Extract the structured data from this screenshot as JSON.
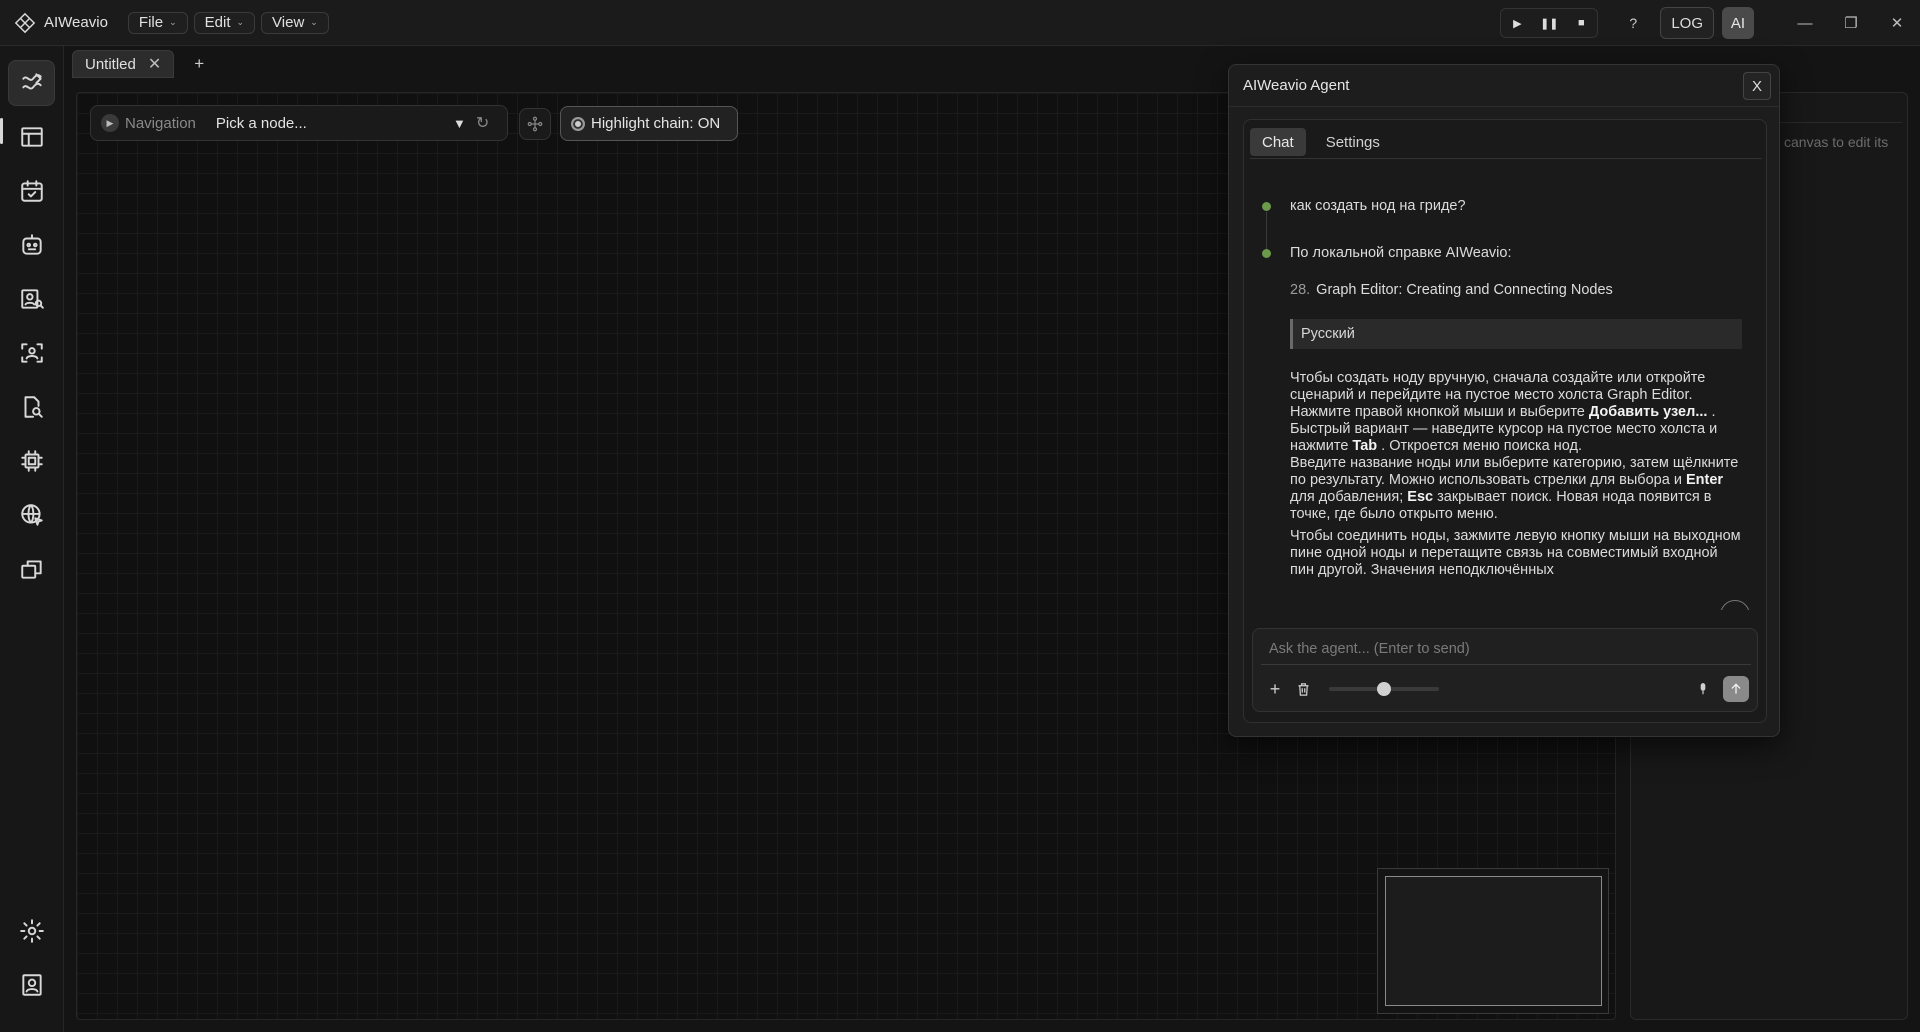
{
  "app": {
    "name": "AIWeavio",
    "menus": [
      "File",
      "Edit",
      "View"
    ]
  },
  "titlebar": {
    "help_label": "?",
    "log_label": "LOG",
    "ai_label": "AI",
    "play_icon": "play-icon",
    "pause_icon": "pause-icon",
    "stop_icon": "stop-icon"
  },
  "sidebar": {
    "items": [
      "graph-editor",
      "dashboard",
      "scheduler",
      "agents",
      "profile-search",
      "capture",
      "document-search",
      "chip",
      "web",
      "windows"
    ],
    "bottom_items": [
      "settings",
      "account"
    ]
  },
  "tabs": {
    "doc_tab_label": "Untitled",
    "add_label": "+"
  },
  "canvas": {
    "navigation_label": "Navigation",
    "node_select_value": "Pick a node...",
    "highlight_chain_label": "Highlight chain: ON"
  },
  "inspector": {
    "hint": "canvas to edit its"
  },
  "agent": {
    "title": "AIWeavio Agent",
    "close_label": "X",
    "tabs": [
      "Chat",
      "Settings"
    ],
    "active_tab": "Chat",
    "user_message": "как создать нод на гриде?",
    "reply_intro": "По локальной справке AIWeavio:",
    "reply_item_number": "28.",
    "reply_item_title": "Graph Editor: Creating and Connecting Nodes",
    "language_label": "Русский",
    "para1_a": "Чтобы создать ноду вручную, сначала создайте или откройте сценарий и перейдите на пустое место холста Graph Editor. Нажмите правой кнопкой мыши и выберите ",
    "para1_b": "Добавить узел...",
    "para1_c": " . Быстрый вариант — наведите курсор на пустое место холста и нажмите ",
    "para1_d": "Tab",
    "para1_e": " . Откроется меню поиска нод.",
    "para2_a": "Введите название ноды или выберите категорию, затем щёлкните по результату. Можно использовать стрелки для выбора и ",
    "para2_b": "Enter",
    "para2_c": " для добавления; ",
    "para2_d": "Esc",
    "para2_e": " закрывает поиск. Новая нода появится в точке, где было открыто меню.",
    "para3": "Чтобы соединить ноды, зажмите левую кнопку мыши на выходном пине одной ноды и перетащите связь на совместимый входной пин другой. Значения неподключённых",
    "input_placeholder": "Ask the agent... (Enter to send)",
    "slider_value": 0.5
  }
}
